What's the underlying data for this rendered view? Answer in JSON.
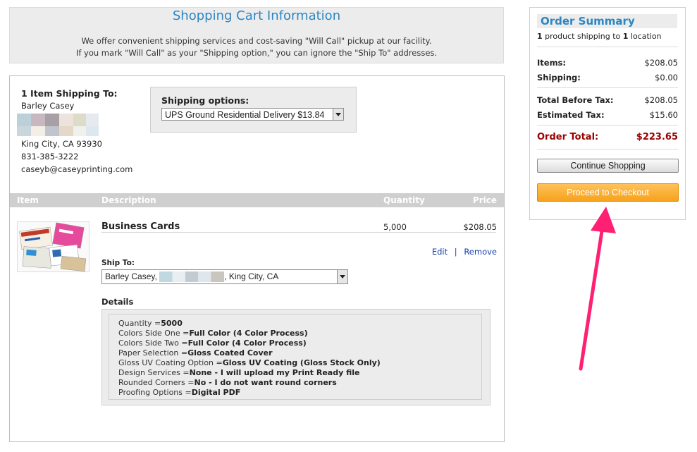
{
  "header": {
    "title": "Shopping Cart Information",
    "line1": "We offer convenient shipping services and cost-saving \"Will Call\" pickup at our facility.",
    "line2": "If you mark \"Will Call\" as your \"Shipping option,\" you can ignore the \"Ship To\" addresses."
  },
  "shipping": {
    "heading": "1 Item Shipping To:",
    "name": "Barley Casey",
    "city": "King City, CA 93930",
    "phone": "831-385-3222",
    "email": "caseyb@caseyprinting.com",
    "options_label": "Shipping options:",
    "options_value": "UPS Ground Residential Delivery $13.84"
  },
  "table": {
    "headers": [
      "Item",
      "Description",
      "Quantity",
      "Price"
    ],
    "item": {
      "description": "Business Cards",
      "quantity": "5,000",
      "price": "$208.05",
      "edit": "Edit",
      "separator": "|",
      "remove": "Remove",
      "ship_to_label": "Ship To:",
      "ship_to_name": "Barley Casey,",
      "ship_to_city": ", King City, CA",
      "details_label": "Details",
      "details": [
        {
          "label": "Quantity =",
          "value": "5000"
        },
        {
          "label": "Colors Side One =",
          "value": "Full Color (4 Color Process)"
        },
        {
          "label": "Colors Side Two =",
          "value": "Full Color (4 Color Process)"
        },
        {
          "label": "Paper Selection =",
          "value": "Gloss Coated Cover"
        },
        {
          "label": "Gloss UV Coating Option =",
          "value": "Gloss UV Coating (Gloss Stock Only)"
        },
        {
          "label": "Design Services =",
          "value": "None - I will upload my Print Ready file"
        },
        {
          "label": "Rounded Corners =",
          "value": "No - I do not want round corners"
        },
        {
          "label": "Proofing Options =",
          "value": "Digital PDF"
        }
      ]
    }
  },
  "summary": {
    "title": "Order Summary",
    "sub_count": "1",
    "sub_text1": " product shipping to ",
    "sub_count2": "1",
    "sub_text2": " location",
    "items_label": "Items:",
    "items_value": "$208.05",
    "shipping_label": "Shipping:",
    "shipping_value": "$0.00",
    "before_tax_label": "Total Before Tax:",
    "before_tax_value": "$208.05",
    "tax_label": "Estimated Tax:",
    "tax_value": "$15.60",
    "total_label": "Order Total:",
    "total_value": "$223.65",
    "continue_label": "Continue Shopping",
    "checkout_label": "Proceed to Checkout"
  },
  "colors": {
    "title_blue": "#2b86c2",
    "total_red": "#990000",
    "link_blue": "#1a3fa8",
    "checkout_orange": "#f7a21c",
    "annotation_arrow": "#ff1f73"
  }
}
